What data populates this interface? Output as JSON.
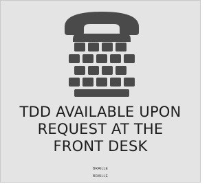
{
  "sign": {
    "title_lines": [
      "TDD AVAILABLE UPON",
      "REQUEST AT THE",
      "FRONT DESK"
    ],
    "braille_lines": [
      "BRAILLE",
      "BRAILLE"
    ]
  },
  "icon": {
    "name": "tdd-telephone-icon",
    "color": "#4a4a4a",
    "background": "#e4e4e4"
  }
}
